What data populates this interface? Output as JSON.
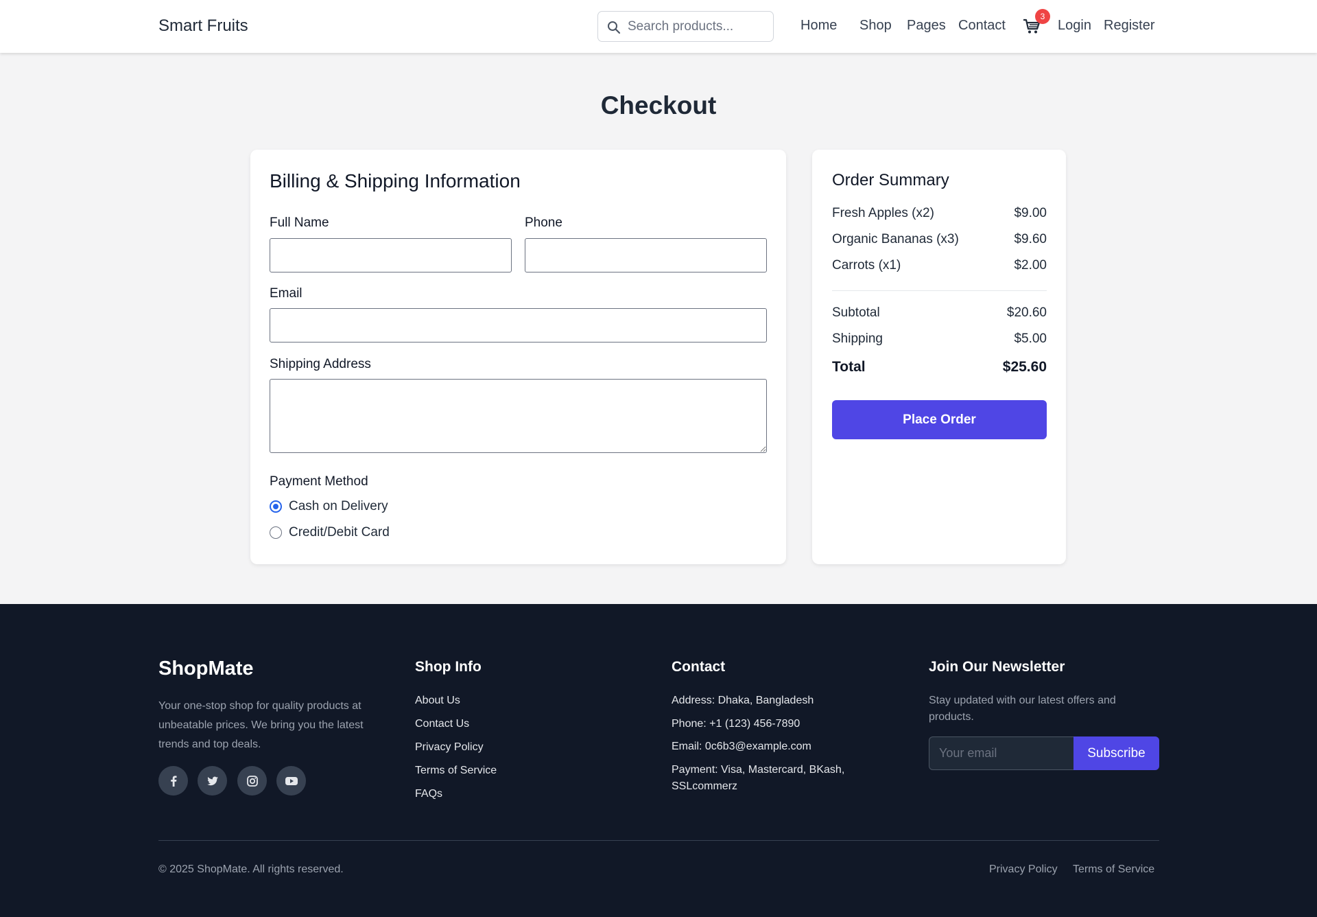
{
  "header": {
    "brand": "Smart Fruits",
    "search_placeholder": "Search products...",
    "nav": [
      "Home",
      "Shop",
      "Pages",
      "Contact"
    ],
    "cart_count": "3",
    "login": "Login",
    "register": "Register"
  },
  "page_title": "Checkout",
  "billing": {
    "title": "Billing & Shipping Information",
    "full_name_label": "Full Name",
    "phone_label": "Phone",
    "email_label": "Email",
    "address_label": "Shipping Address",
    "payment_label": "Payment Method",
    "payment_options": [
      "Cash on Delivery",
      "Credit/Debit Card"
    ],
    "selected_payment": "Cash on Delivery"
  },
  "summary": {
    "title": "Order Summary",
    "items": [
      {
        "name": "Fresh Apples (x2)",
        "price": "$9.00"
      },
      {
        "name": "Organic Bananas (x3)",
        "price": "$9.60"
      },
      {
        "name": "Carrots (x1)",
        "price": "$2.00"
      }
    ],
    "subtotal_label": "Subtotal",
    "subtotal": "$20.60",
    "shipping_label": "Shipping",
    "shipping": "$5.00",
    "total_label": "Total",
    "total": "$25.60",
    "place_order": "Place Order"
  },
  "footer": {
    "brand": "ShopMate",
    "description": "Your one-stop shop for quality products at unbeatable prices. We bring you the latest trends and top deals.",
    "social": [
      "facebook-icon",
      "twitter-icon",
      "instagram-icon",
      "youtube-icon"
    ],
    "shop_info_title": "Shop Info",
    "shop_info_links": [
      "About Us",
      "Contact Us",
      "Privacy Policy",
      "Terms of Service",
      "FAQs"
    ],
    "contact_title": "Contact",
    "contact": [
      "Address: Dhaka, Bangladesh",
      "Phone: +1 (123) 456-7890",
      "Email: 0c6b3@example.com",
      "Payment: Visa, Mastercard, BKash, SSLcommerz"
    ],
    "newsletter_title": "Join Our Newsletter",
    "newsletter_desc": "Stay updated with our latest offers and products.",
    "email_placeholder": "Your email",
    "subscribe": "Subscribe",
    "copyright": "© 2025 ShopMate. All rights reserved.",
    "bottom_links": [
      "Privacy Policy",
      "Terms of Service"
    ]
  },
  "colors": {
    "accent": "#4f46e5",
    "footer_bg": "#111827",
    "badge": "#ef4444",
    "radio": "#2563eb"
  }
}
